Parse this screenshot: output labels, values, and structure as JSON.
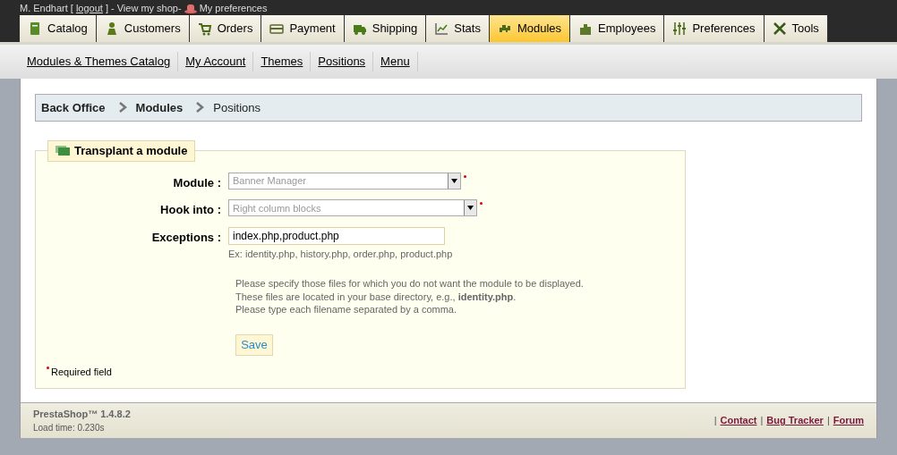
{
  "top_bar": {
    "user": "M. Endhart [",
    "logout": "logout",
    "sep1": "] - ",
    "view_shop": "View my shop",
    "sep2": " - ",
    "preferences": "My preferences"
  },
  "tabs": [
    {
      "label": "Catalog",
      "selected": false
    },
    {
      "label": "Customers",
      "selected": false
    },
    {
      "label": "Orders",
      "selected": false
    },
    {
      "label": "Payment",
      "selected": false
    },
    {
      "label": "Shipping",
      "selected": false
    },
    {
      "label": "Stats",
      "selected": false
    },
    {
      "label": "Modules",
      "selected": true
    },
    {
      "label": "Employees",
      "selected": false
    },
    {
      "label": "Preferences",
      "selected": false
    },
    {
      "label": "Tools",
      "selected": false
    }
  ],
  "sub_menu": [
    "Modules & Themes Catalog",
    "My Account",
    "Themes",
    "Positions",
    "Menu"
  ],
  "breadcrumb": [
    {
      "label": "Back Office",
      "current": false
    },
    {
      "label": "Modules",
      "current": false
    },
    {
      "label": "Positions",
      "current": true
    }
  ],
  "form": {
    "legend": "Transplant a module",
    "fields": [
      {
        "kind": "select",
        "label": "Module :",
        "value": "Banner Manager",
        "disabled": true,
        "required": true
      },
      {
        "kind": "select",
        "label": "Hook into :",
        "value": "Right column blocks",
        "disabled": true,
        "required": true
      },
      {
        "kind": "text",
        "label": "Exceptions :",
        "value": "index.php,product.php",
        "required": false,
        "example": "Ex: identity.php, history.php, order.php, product.php"
      }
    ],
    "help": [
      "Please specify those files for which you do not want the module to be displayed.",
      "These files are located in your base directory, e.g., **identity.php**.",
      "Please type each filename separated by a comma."
    ],
    "save_button": "Save",
    "required_note": "Required field"
  },
  "footer": {
    "version": "PrestaShop™ 1.4.8.2",
    "load_time": "Load time: 0.230s",
    "links": [
      {
        "separator": "|",
        "label": "Contact"
      },
      {
        "separator": "|",
        "label": "Bug Tracker"
      },
      {
        "separator": "|",
        "label": "Forum"
      }
    ]
  }
}
